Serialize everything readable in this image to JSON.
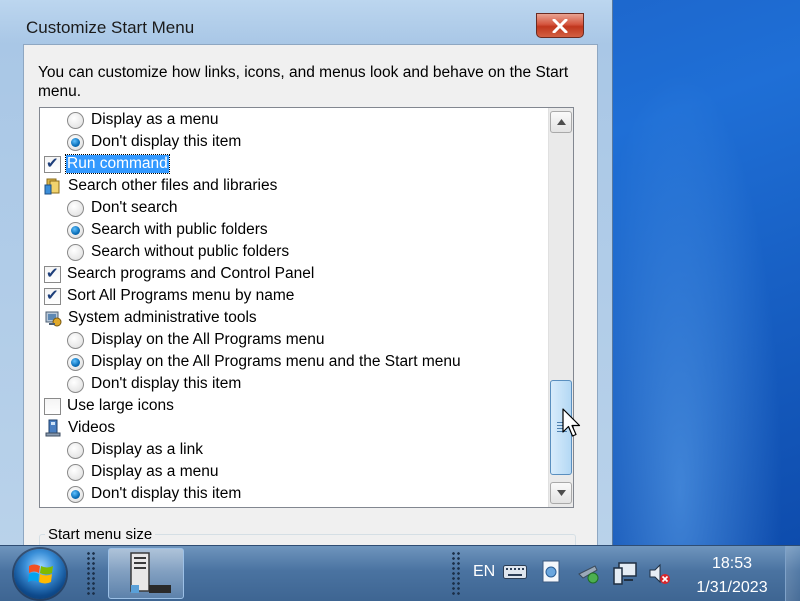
{
  "window": {
    "title": "Customize Start Menu",
    "intro_text": "You can customize how links, icons, and menus look and behave on the Start menu."
  },
  "options": [
    {
      "kind": "radio",
      "label": "Display as a menu",
      "checked": false
    },
    {
      "kind": "radio",
      "label": "Don't display this item",
      "checked": true
    },
    {
      "kind": "checkbox",
      "label": "Run command",
      "checked": true,
      "selected": true
    },
    {
      "kind": "group",
      "label": "Search other files and libraries",
      "icon": "folder-icon"
    },
    {
      "kind": "radio",
      "label": "Don't search",
      "checked": false
    },
    {
      "kind": "radio",
      "label": "Search with public folders",
      "checked": true
    },
    {
      "kind": "radio",
      "label": "Search without public folders",
      "checked": false
    },
    {
      "kind": "checkbox",
      "label": "Search programs and Control Panel",
      "checked": true
    },
    {
      "kind": "checkbox",
      "label": "Sort All Programs menu by name",
      "checked": true
    },
    {
      "kind": "group",
      "label": "System administrative tools",
      "icon": "admin-tools-icon"
    },
    {
      "kind": "radio",
      "label": "Display on the All Programs menu",
      "checked": false
    },
    {
      "kind": "radio",
      "label": "Display on the All Programs menu and the Start menu",
      "checked": true
    },
    {
      "kind": "radio",
      "label": "Don't display this item",
      "checked": false
    },
    {
      "kind": "checkbox",
      "label": "Use large icons",
      "checked": false
    },
    {
      "kind": "group",
      "label": "Videos",
      "icon": "videos-icon"
    },
    {
      "kind": "radio",
      "label": "Display as a link",
      "checked": false
    },
    {
      "kind": "radio",
      "label": "Display as a menu",
      "checked": false
    },
    {
      "kind": "radio",
      "label": "Don't display this item",
      "checked": true
    }
  ],
  "start_menu_size": {
    "label": "Start menu size"
  },
  "taskbar": {
    "language": "EN",
    "time": "18:53",
    "date": "1/31/2023"
  },
  "colors": {
    "selection": "#3399ff",
    "close_button": "#c0361d",
    "taskbar": "#4a73a1"
  }
}
